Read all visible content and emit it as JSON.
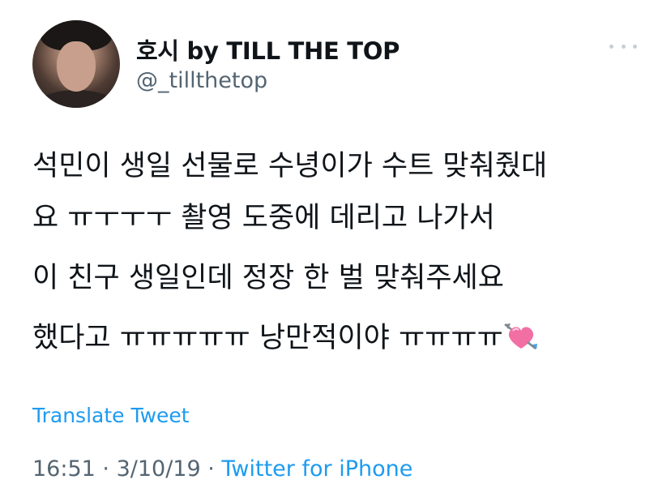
{
  "user": {
    "display_name": "호시 by TILL THE TOP",
    "handle": "@_tillthetop"
  },
  "tweet": {
    "lines": [
      "석민이 생일 선물로 수녕이가 수트 맞춰줬대",
      "요 ㅠㅜㅜㅜ 촬영 도중에 데리고 나가서",
      "이 친구 생일인데 정장 한 벌 맞춰주세요",
      "했다고 ㅠㅠㅠㅠㅠ 낭만적이야 ㅠㅠㅠㅠ"
    ],
    "emoji": "heart-with-arrow-icon"
  },
  "translate_label": "Translate Tweet",
  "meta": {
    "time": "16:51",
    "separator1": " · ",
    "date": "3/10/19",
    "separator2": " · ",
    "source": "Twitter for iPhone"
  },
  "colors": {
    "link": "#1d9bf0",
    "secondary": "#536471",
    "text": "#0f1419"
  }
}
